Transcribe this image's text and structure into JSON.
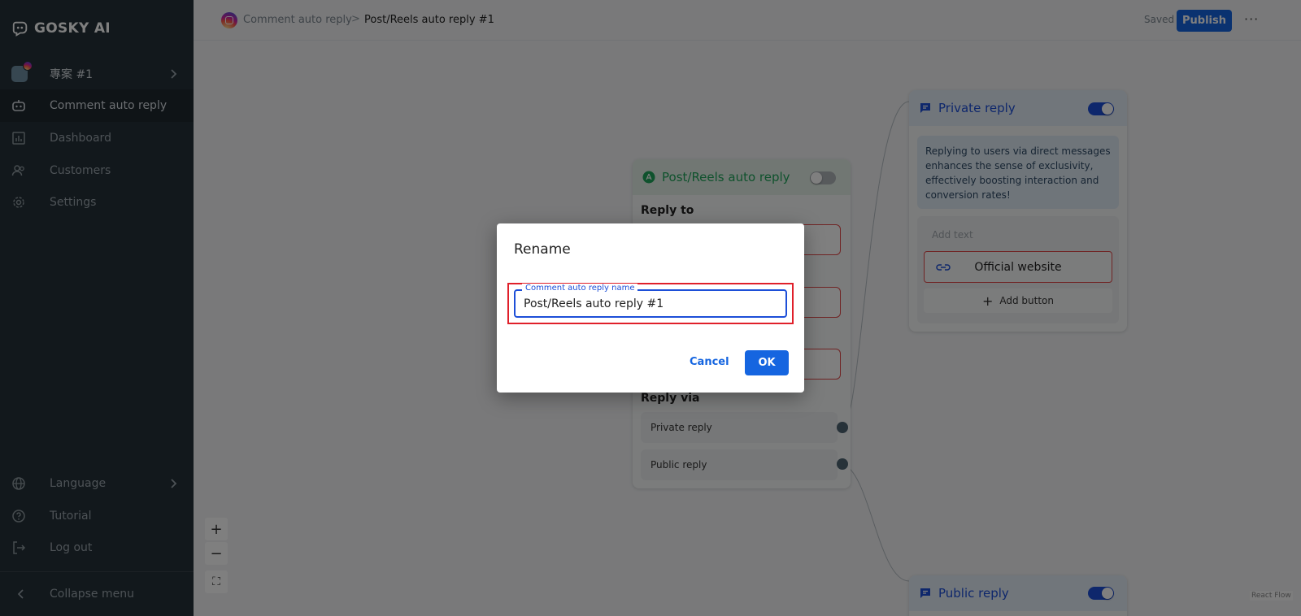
{
  "app": {
    "name": "GOSKY AI"
  },
  "sidebar": {
    "project": {
      "label": "專案 #1"
    },
    "items": [
      {
        "label": "Comment auto reply",
        "icon": "robot-icon",
        "active": true
      },
      {
        "label": "Dashboard",
        "icon": "chart-icon"
      },
      {
        "label": "Customers",
        "icon": "users-icon"
      },
      {
        "label": "Settings",
        "icon": "gear-icon"
      }
    ],
    "bottom": [
      {
        "label": "Language",
        "icon": "globe-icon"
      },
      {
        "label": "Tutorial",
        "icon": "help-icon"
      },
      {
        "label": "Log out",
        "icon": "logout-icon"
      }
    ],
    "collapse_label": "Collapse menu"
  },
  "topbar": {
    "breadcrumb_root": "Comment auto reply",
    "breadcrumb_separator": ">",
    "breadcrumb_current": "Post/Reels auto reply #1",
    "saved_label": "Saved",
    "publish_label": "Publish",
    "more_label": "···"
  },
  "canvas": {
    "trigger_node": {
      "title": "Post/Reels auto reply",
      "enabled": false,
      "reply_to_label": "Reply to",
      "reply_via_label": "Reply via",
      "via_options": [
        "Private reply",
        "Public reply"
      ]
    },
    "private_node": {
      "title": "Private reply",
      "enabled": true,
      "description": "Replying to users via direct messages enhances the sense of exclusivity, effectively boosting interaction and conversion rates!",
      "add_text_placeholder": "Add text",
      "link_button_label": "Official website",
      "add_button_label": "Add button"
    },
    "public_node": {
      "title": "Public reply",
      "enabled": true
    },
    "zoom_in": "+",
    "zoom_out": "−",
    "fit_view": "⛶",
    "attribution": "React Flow"
  },
  "dialog": {
    "title": "Rename",
    "field_label": "Comment auto reply name",
    "field_value": "Post/Reels auto reply #1",
    "cancel_label": "Cancel",
    "ok_label": "OK"
  },
  "colors": {
    "primary": "#1565e0",
    "sidebar_bg": "#253038",
    "trigger_green": "#1fa45a",
    "private_blue": "#1d4fd8",
    "error_red": "#e0202a"
  }
}
